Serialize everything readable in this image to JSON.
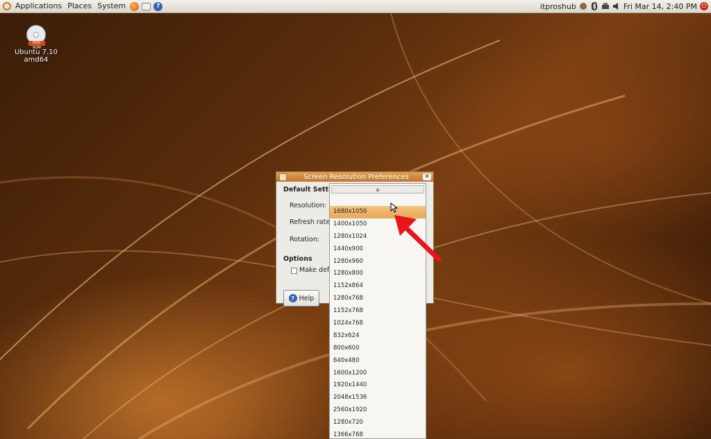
{
  "top_panel": {
    "menu": [
      "Applications",
      "Places",
      "System"
    ],
    "username": "itproshub",
    "clock": "Fri Mar 14,  2:40 PM"
  },
  "desktop": {
    "dvd_badge": "DVD-ROM",
    "dvd_caption": "Ubuntu 7.10 amd64"
  },
  "dialog": {
    "title": "Screen Resolution Preferences",
    "default_settings": "Default Setting",
    "labels": {
      "resolution": "Resolution:",
      "refresh_rate": "Refresh rate:",
      "rotation": "Rotation:"
    },
    "options_heading": "Options",
    "make_default": "Make defau",
    "help_button": "Help"
  },
  "dropdown": {
    "selected": "1680x1050",
    "options": [
      "1680x1050",
      "1400x1050",
      "1280x1024",
      "1440x900",
      "1280x960",
      "1280x800",
      "1152x864",
      "1280x768",
      "1152x768",
      "1024x768",
      "832x624",
      "800x600",
      "640x480",
      "1600x1200",
      "1920x1440",
      "2048x1536",
      "2560x1920",
      "1280x720",
      "1366x768"
    ]
  },
  "colors": {
    "highlight": "#f0b86c",
    "arrow": "#e8161a",
    "titlebar": "#d38a40"
  }
}
